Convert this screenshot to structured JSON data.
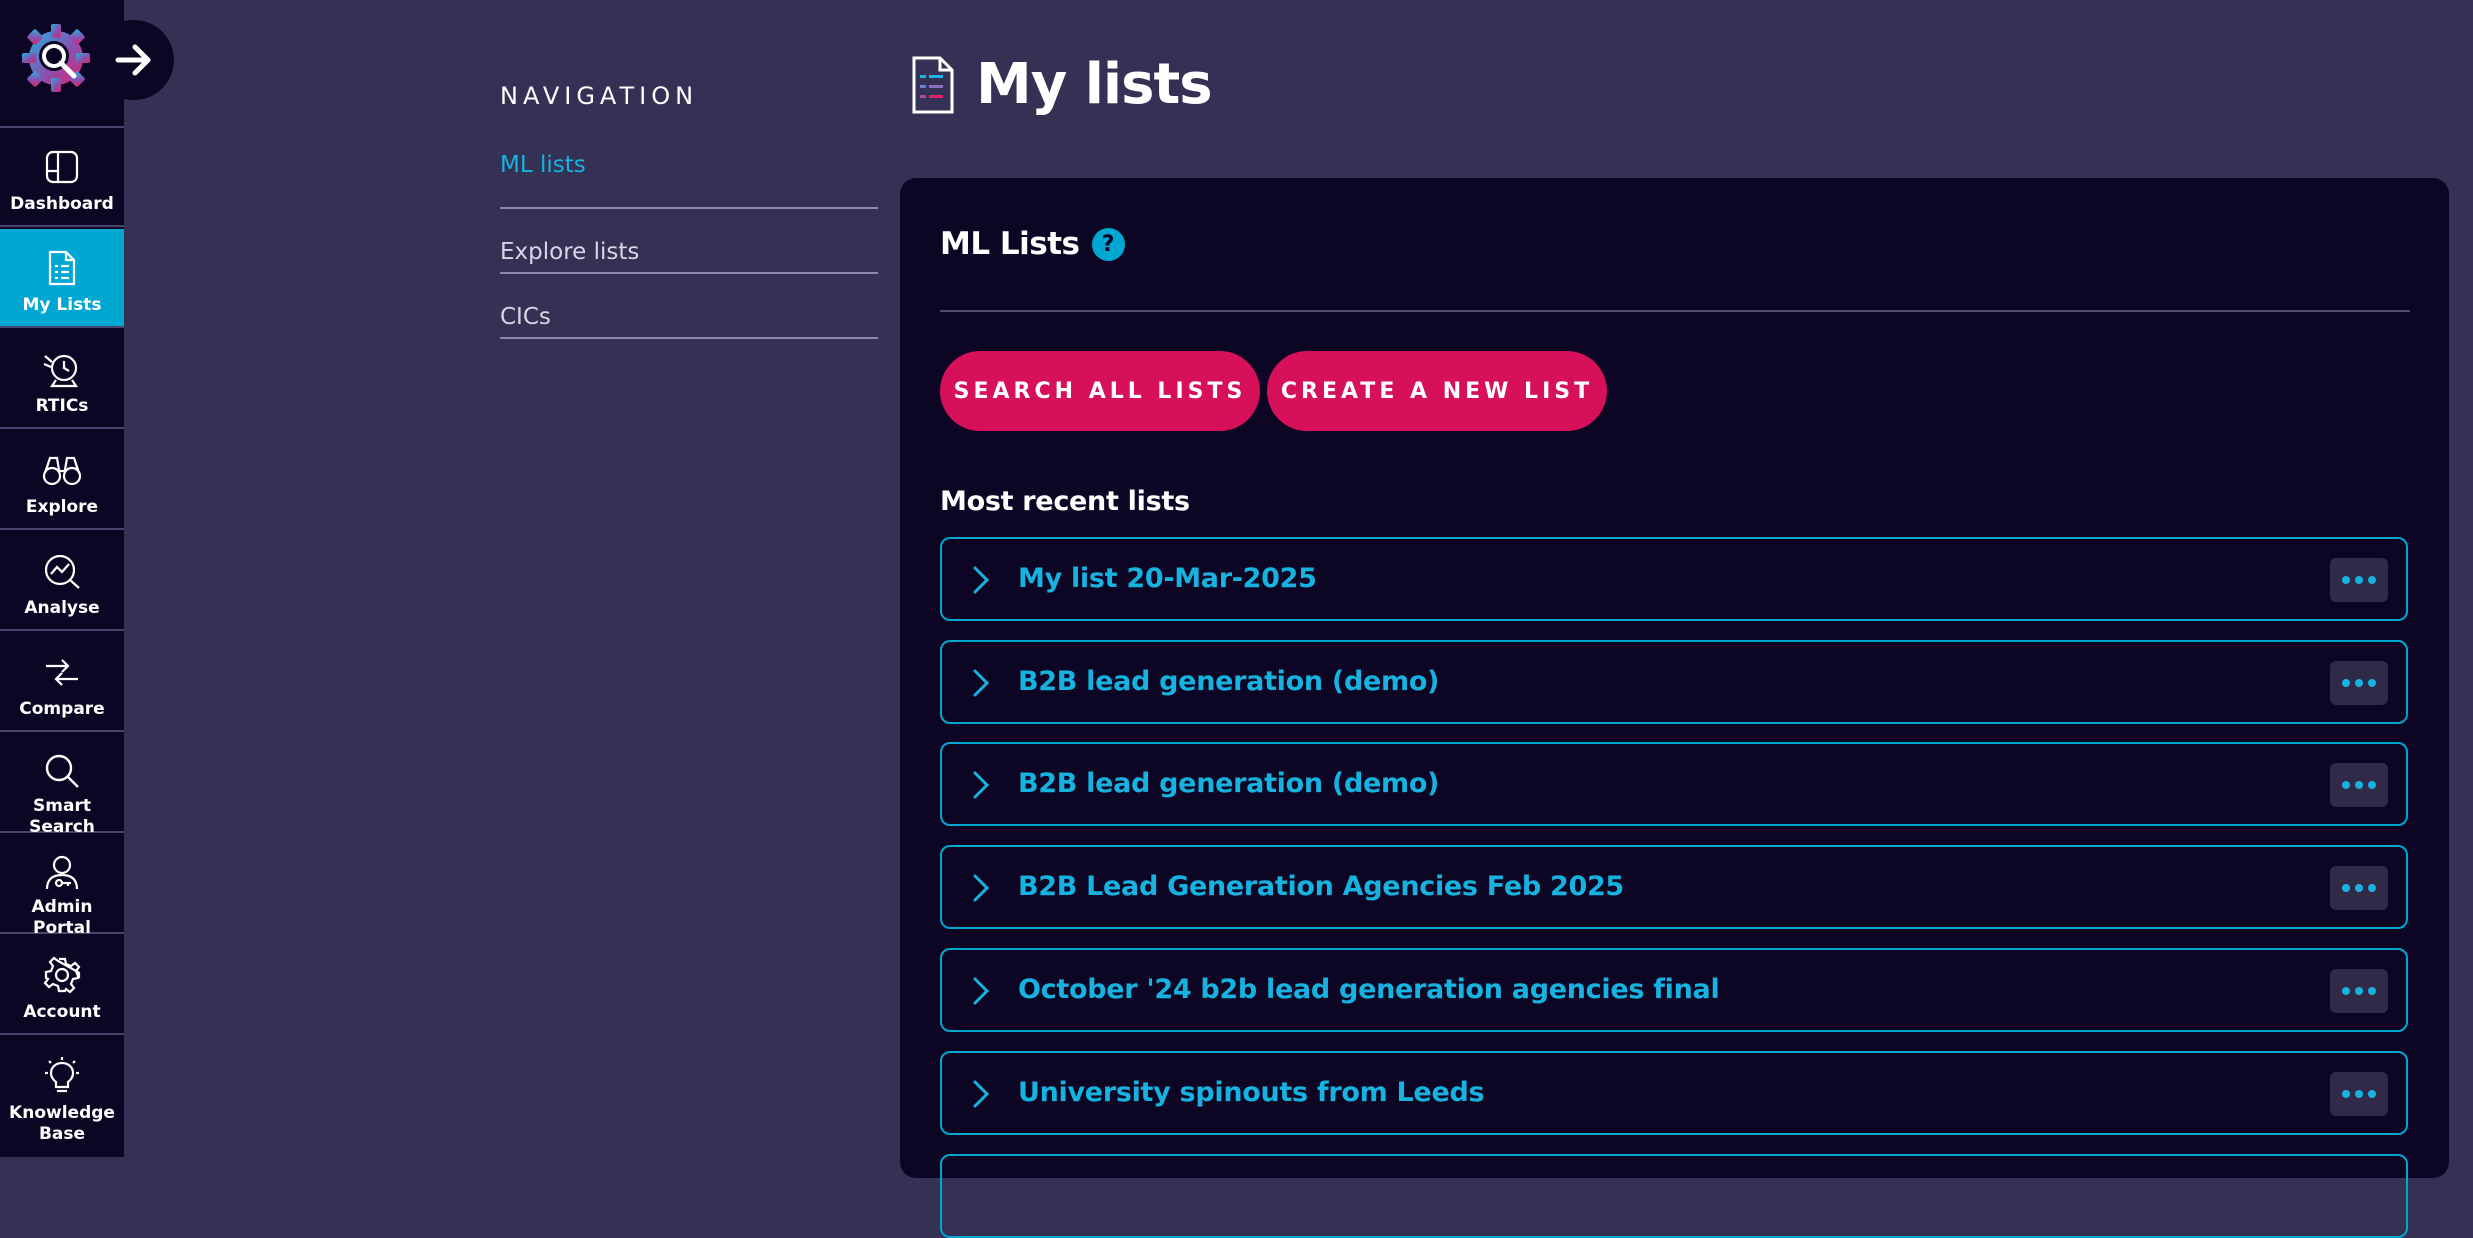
{
  "rail": {
    "items": [
      {
        "label": "Dashboard",
        "icon": "dashboard-icon",
        "active": false
      },
      {
        "label": "My Lists",
        "icon": "lists-icon",
        "active": true
      },
      {
        "label": "RTICs",
        "icon": "rtics-icon",
        "active": false
      },
      {
        "label": "Explore",
        "icon": "binoculars-icon",
        "active": false
      },
      {
        "label": "Analyse",
        "icon": "analyse-icon",
        "active": false
      },
      {
        "label": "Compare",
        "icon": "compare-icon",
        "active": false
      },
      {
        "label": "Smart Search",
        "icon": "search-icon",
        "active": false
      },
      {
        "label": "Admin Portal",
        "icon": "admin-icon",
        "active": false
      },
      {
        "label": "Account",
        "icon": "gear-icon",
        "active": false
      },
      {
        "label": "Knowledge Base",
        "icon": "lightbulb-icon",
        "active": false
      }
    ]
  },
  "subnav": {
    "title": "NAVIGATION",
    "items": [
      {
        "label": "ML lists",
        "active": true
      },
      {
        "label": "Explore lists",
        "active": false
      },
      {
        "label": "CICs",
        "active": false
      }
    ]
  },
  "header": {
    "title": "My lists"
  },
  "panel": {
    "title": "ML Lists",
    "help": "?",
    "search_all_label": "SEARCH ALL LISTS",
    "create_label": "CREATE A NEW LIST",
    "recent_title": "Most recent lists",
    "lists": [
      {
        "title": "My list 20-Mar-2025"
      },
      {
        "title": "B2B lead generation (demo)"
      },
      {
        "title": "B2B lead generation (demo)"
      },
      {
        "title": "B2B Lead Generation Agencies Feb 2025"
      },
      {
        "title": "October '24 b2b lead generation agencies final"
      },
      {
        "title": "University spinouts from Leeds"
      }
    ]
  },
  "colors": {
    "background": "#353155",
    "panel": "#0c0624",
    "accent": "#00a7d0",
    "button": "#d6115a"
  }
}
